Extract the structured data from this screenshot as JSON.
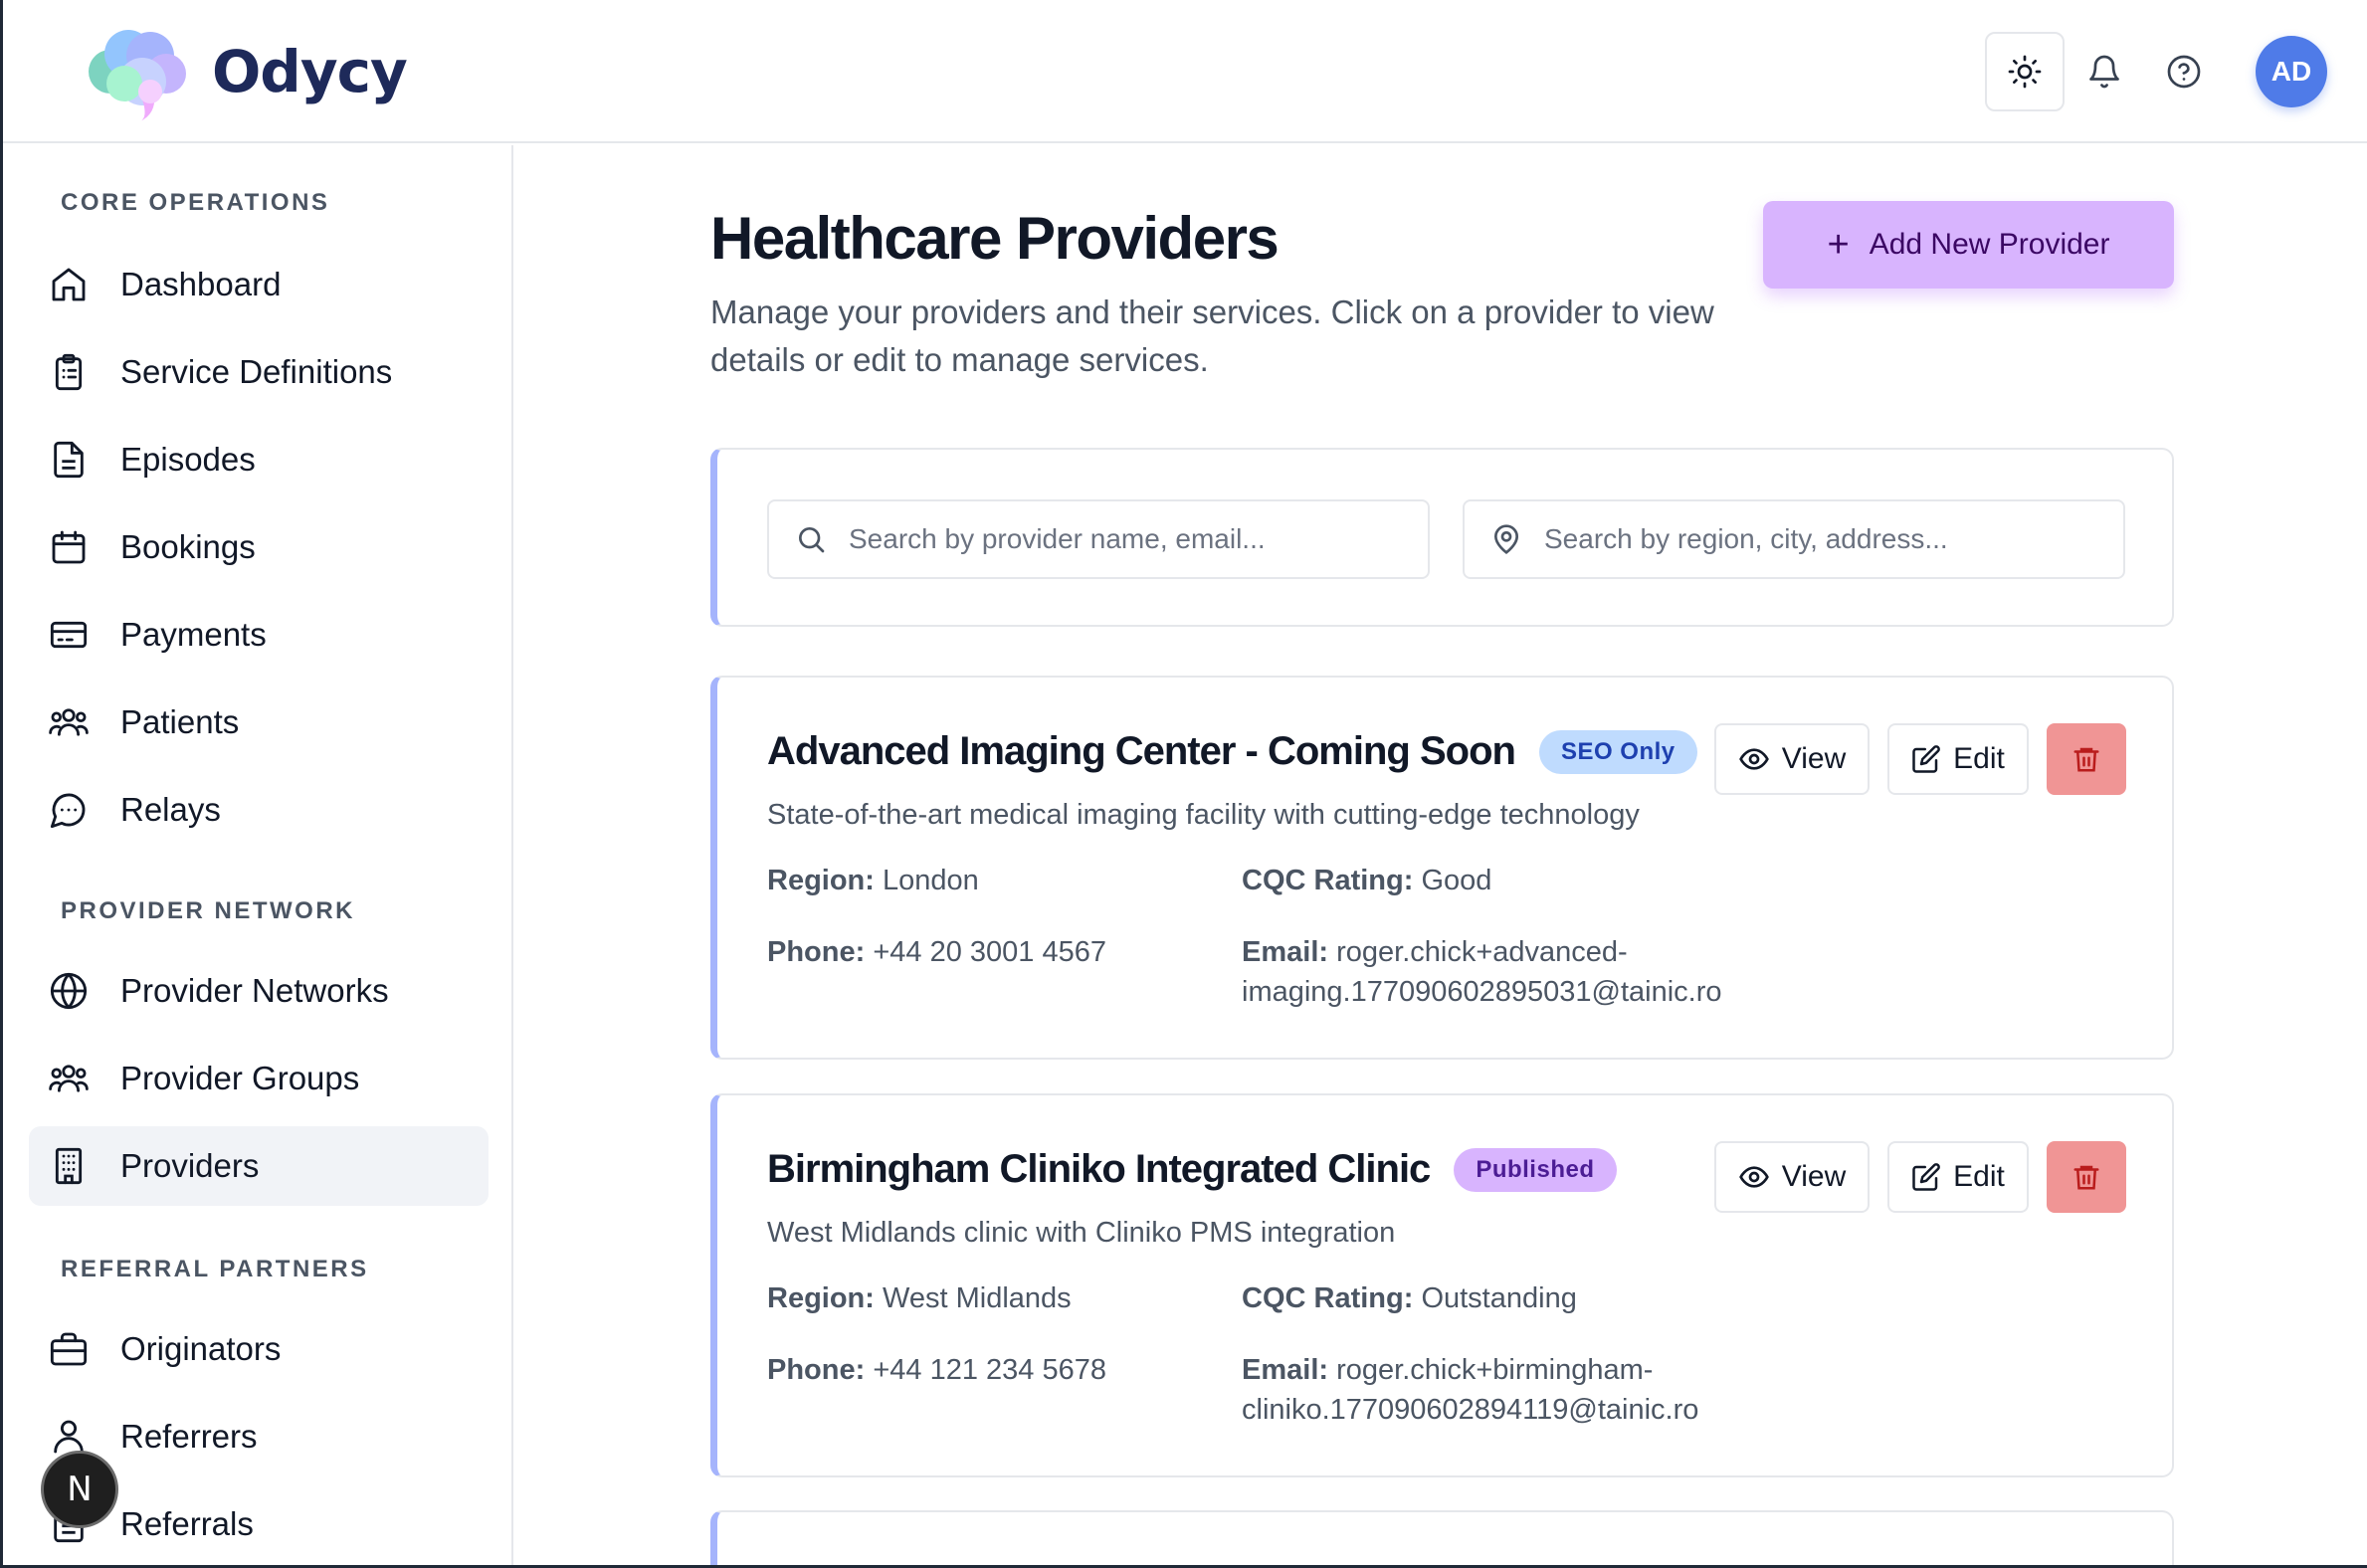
{
  "app": {
    "name": "Odycy",
    "user_initials": "AD"
  },
  "sidebar": {
    "sections": [
      {
        "title": "CORE OPERATIONS",
        "items": [
          {
            "label": "Dashboard",
            "icon": "home-icon"
          },
          {
            "label": "Service Definitions",
            "icon": "clipboard-icon"
          },
          {
            "label": "Episodes",
            "icon": "file-icon"
          },
          {
            "label": "Bookings",
            "icon": "calendar-icon"
          },
          {
            "label": "Payments",
            "icon": "credit-card-icon"
          },
          {
            "label": "Patients",
            "icon": "users-icon"
          },
          {
            "label": "Relays",
            "icon": "chat-icon"
          }
        ]
      },
      {
        "title": "PROVIDER NETWORK",
        "items": [
          {
            "label": "Provider Networks",
            "icon": "globe-icon"
          },
          {
            "label": "Provider Groups",
            "icon": "users-icon"
          },
          {
            "label": "Providers",
            "icon": "building-icon",
            "active": true
          }
        ]
      },
      {
        "title": "REFERRAL PARTNERS",
        "items": [
          {
            "label": "Originators",
            "icon": "briefcase-icon"
          },
          {
            "label": "Referrers",
            "icon": "user-icon"
          },
          {
            "label": "Referrals",
            "icon": "file-icon"
          }
        ]
      }
    ],
    "floating_badge": "N"
  },
  "main": {
    "title": "Healthcare Providers",
    "subtitle": "Manage your providers and their services. Click on a provider to view details or edit to manage services.",
    "add_button": "Add New Provider",
    "search": {
      "name_placeholder": "Search by provider name, email...",
      "region_placeholder": "Search by region, city, address..."
    },
    "labels": {
      "region": "Region:",
      "cqc": "CQC Rating:",
      "phone": "Phone:",
      "email": "Email:",
      "view": "View",
      "edit": "Edit"
    },
    "providers": [
      {
        "name": "Advanced Imaging Center - Coming Soon",
        "status": "SEO Only",
        "description": "State-of-the-art medical imaging facility with cutting-edge technology",
        "region": "London",
        "cqc_rating": "Good",
        "phone": "+44 20 3001 4567",
        "email_line1": "roger.chick+advanced-",
        "email_line2": "imaging.177090602895031@tainic.ro"
      },
      {
        "name": "Birmingham Cliniko Integrated Clinic",
        "status": "Published",
        "description": "West Midlands clinic with Cliniko PMS integration",
        "region": "West Midlands",
        "cqc_rating": "Outstanding",
        "phone": "+44 121 234 5678",
        "email_line1": "roger.chick+birmingham-",
        "email_line2": "cliniko.177090602894119@tainic.ro"
      }
    ]
  },
  "colors": {
    "accent": "#d8b4fe",
    "avatar": "#4f7be8",
    "card_border_left": "#a5b4fc",
    "delete": "#f09595"
  }
}
